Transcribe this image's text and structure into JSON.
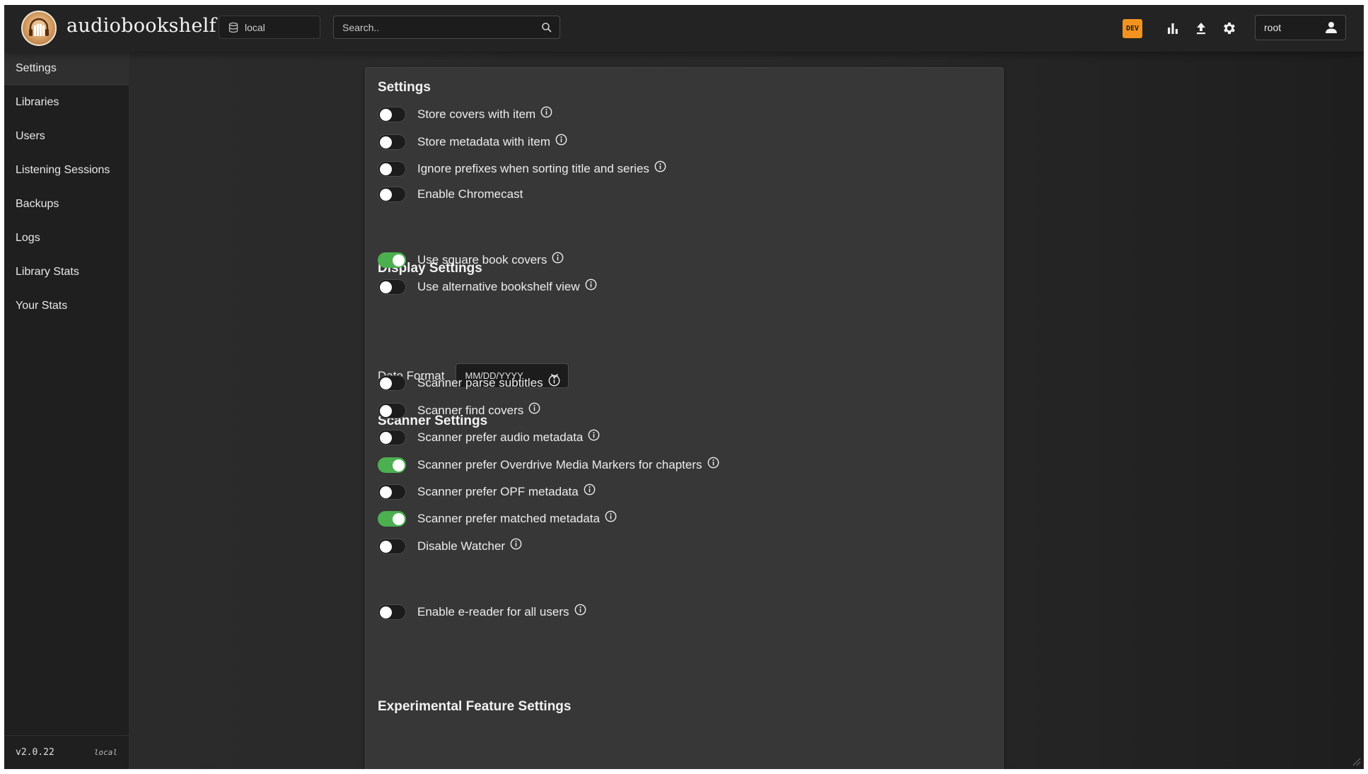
{
  "app": {
    "name": "audiobookshelf"
  },
  "header": {
    "library_name": "local",
    "search_placeholder": "Search..",
    "dev_badge": "DEV",
    "username": "root",
    "icons": [
      "database-icon",
      "search-icon",
      "bar-chart-icon",
      "upload-icon",
      "gear-icon",
      "person-icon"
    ]
  },
  "sidebar": {
    "items": [
      {
        "label": "Settings",
        "active": true
      },
      {
        "label": "Libraries"
      },
      {
        "label": "Users"
      },
      {
        "label": "Listening Sessions"
      },
      {
        "label": "Backups"
      },
      {
        "label": "Logs"
      },
      {
        "label": "Library Stats"
      },
      {
        "label": "Your Stats"
      }
    ],
    "version": "v2.0.22",
    "source": "local"
  },
  "settings": {
    "title": "Settings",
    "items": [
      {
        "label": "Store covers with item",
        "enabled": false,
        "info": true
      },
      {
        "label": "Store metadata with item",
        "enabled": false,
        "info": true
      },
      {
        "label": "Ignore prefixes when sorting title and series",
        "enabled": false,
        "info": true
      },
      {
        "label": "Enable Chromecast",
        "enabled": false,
        "info": false
      }
    ]
  },
  "display": {
    "title": "Display Settings",
    "items": [
      {
        "label": "Use square book covers",
        "enabled": true,
        "info": true
      },
      {
        "label": "Use alternative bookshelf view",
        "enabled": false,
        "info": true
      }
    ],
    "date_format_label": "Date Format",
    "date_format_value": "MM/DD/YYYY"
  },
  "scanner": {
    "title": "Scanner Settings",
    "items": [
      {
        "label": "Scanner parse subtitles",
        "enabled": false,
        "info": true
      },
      {
        "label": "Scanner find covers",
        "enabled": false,
        "info": true
      },
      {
        "label": "Scanner prefer audio metadata",
        "enabled": false,
        "info": true
      },
      {
        "label": "Scanner prefer Overdrive Media Markers for chapters",
        "enabled": true,
        "info": true
      },
      {
        "label": "Scanner prefer OPF metadata",
        "enabled": false,
        "info": true
      },
      {
        "label": "Scanner prefer matched metadata",
        "enabled": true,
        "info": true
      },
      {
        "label": "Disable Watcher",
        "enabled": false,
        "info": true
      }
    ]
  },
  "experimental": {
    "title": "Experimental Feature Settings",
    "items": [
      {
        "label": "Enable e-reader for all users",
        "enabled": false,
        "info": true
      }
    ]
  },
  "colors": {
    "toggle_on": "#4caf50",
    "toggle_off": "#1c1c1c",
    "dev_badge": "#f3931f",
    "background": "#262626",
    "panel": "#373737"
  }
}
